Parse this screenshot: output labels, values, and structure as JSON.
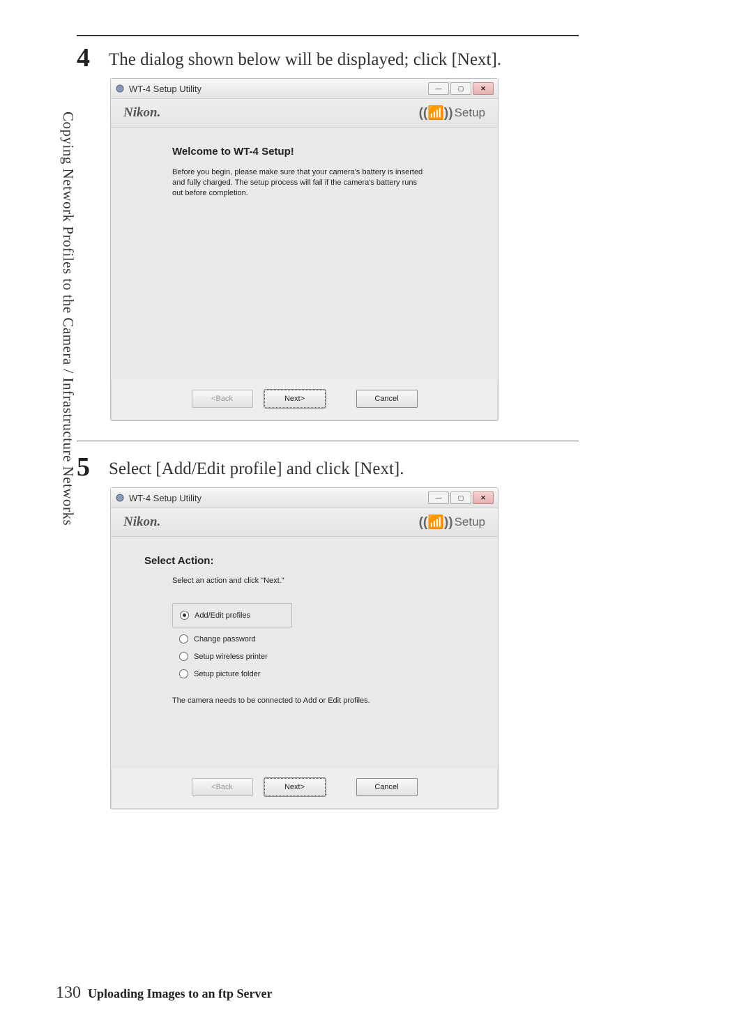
{
  "sideText": "Copying Network Profiles to the Camera / Infrastructure Networks",
  "step4": {
    "num": "4",
    "text": "The dialog shown below will be displayed; click [Next]."
  },
  "step5": {
    "num": "5",
    "text": "Select [Add/Edit profile] and click [Next]."
  },
  "dialog1": {
    "windowTitle": "WT-4 Setup Utility",
    "brand": "Nikon.",
    "setupLabel": "Setup",
    "heading": "Welcome to WT-4 Setup!",
    "body": "Before you begin, please make sure that your camera's battery is inserted and fully charged. The setup process will fail if the camera's battery runs out before completion.",
    "back": "<Back",
    "next": "Next>",
    "cancel": "Cancel"
  },
  "dialog2": {
    "windowTitle": "WT-4 Setup Utility",
    "brand": "Nikon.",
    "setupLabel": "Setup",
    "heading": "Select Action:",
    "sub": "Select an action and click \"Next.\"",
    "opt1": "Add/Edit profiles",
    "opt2": "Change password",
    "opt3": "Setup wireless printer",
    "opt4": "Setup picture folder",
    "note": "The camera needs to be connected to Add or Edit profiles.",
    "back": "<Back",
    "next": "Next>",
    "cancel": "Cancel"
  },
  "footer": {
    "page": "130",
    "title": "Uploading Images to an ftp Server"
  }
}
